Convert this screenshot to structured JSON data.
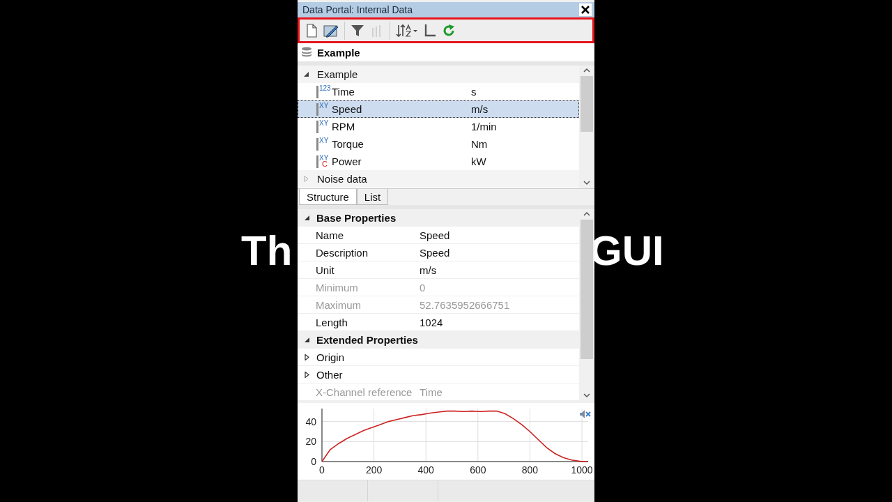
{
  "captions": [
    {
      "text": "Th"
    },
    {
      "text": "GUI"
    }
  ],
  "window": {
    "title": "Data Portal: Internal Data"
  },
  "toolbar": {
    "highlighted": true,
    "items": [
      {
        "kind": "new",
        "disabled": false
      },
      {
        "kind": "edit",
        "disabled": false
      },
      {
        "kind": "filter",
        "disabled": false,
        "group_start": true
      },
      {
        "kind": "bars",
        "disabled": true
      },
      {
        "kind": "sort",
        "disabled": false,
        "group_start": true
      },
      {
        "kind": "axis",
        "disabled": false
      },
      {
        "kind": "refresh",
        "disabled": false
      }
    ]
  },
  "source": {
    "name": "Example"
  },
  "tree": [
    {
      "name": "Example",
      "expanded": true,
      "children": [
        {
          "type_label": "123",
          "name": "Time",
          "unit": "s",
          "selected": false
        },
        {
          "type_label": "XY",
          "name": "Speed",
          "unit": "m/s",
          "selected": true
        },
        {
          "type_label": "XY",
          "name": "RPM",
          "unit": "1/min",
          "selected": false
        },
        {
          "type_label": "XY",
          "name": "Torque",
          "unit": "Nm",
          "selected": false
        },
        {
          "type_label": "XY",
          "type_sublabel": "C",
          "name": "Power",
          "unit": "kW",
          "selected": false
        }
      ]
    },
    {
      "name": "Noise data",
      "expanded": false
    }
  ],
  "tabs": [
    {
      "label": "Structure",
      "selected": true
    },
    {
      "label": "List",
      "selected": false
    }
  ],
  "properties": [
    {
      "kind": "group",
      "name": "Base Properties",
      "expanded": true
    },
    {
      "kind": "row",
      "name": "Name",
      "value": "Speed",
      "disabled": false
    },
    {
      "kind": "row",
      "name": "Description",
      "value": "Speed",
      "disabled": false
    },
    {
      "kind": "row",
      "name": "Unit",
      "value": "m/s",
      "disabled": false
    },
    {
      "kind": "row",
      "name": "Minimum",
      "value": "0",
      "disabled": true
    },
    {
      "kind": "row",
      "name": "Maximum",
      "value": "52.7635952666751",
      "disabled": true
    },
    {
      "kind": "row",
      "name": "Length",
      "value": "1024",
      "disabled": false
    },
    {
      "kind": "group",
      "name": "Extended Properties",
      "expanded": true
    },
    {
      "kind": "subgroup",
      "name": "Origin",
      "expanded": false
    },
    {
      "kind": "subgroup",
      "name": "Other",
      "expanded": false
    },
    {
      "kind": "row",
      "name": "X-Channel reference",
      "value": "Time",
      "disabled": true
    }
  ],
  "chart_data": {
    "type": "line",
    "x": [
      0,
      32,
      64,
      96,
      128,
      160,
      192,
      224,
      256,
      288,
      320,
      352,
      384,
      416,
      448,
      480,
      512,
      544,
      576,
      608,
      640,
      672,
      704,
      736,
      768,
      800,
      832,
      864,
      896,
      928,
      960,
      992,
      1024
    ],
    "grid": true,
    "series": [
      {
        "color": "#cc2222",
        "values": [
          0,
          12,
          18,
          23,
          27,
          31,
          34,
          37,
          40,
          42,
          44,
          46,
          47,
          48.5,
          49.5,
          50.5,
          50.5,
          50,
          50.5,
          50,
          50.5,
          50.5,
          48,
          43,
          37,
          30,
          22,
          14,
          8,
          4,
          1.5,
          0.3,
          0
        ]
      }
    ],
    "xlim": [
      0,
      1024
    ],
    "ylim": [
      0,
      53
    ],
    "xticks": [
      0,
      200,
      400,
      600,
      800,
      1000
    ],
    "yticks": [
      0,
      20,
      40
    ]
  }
}
